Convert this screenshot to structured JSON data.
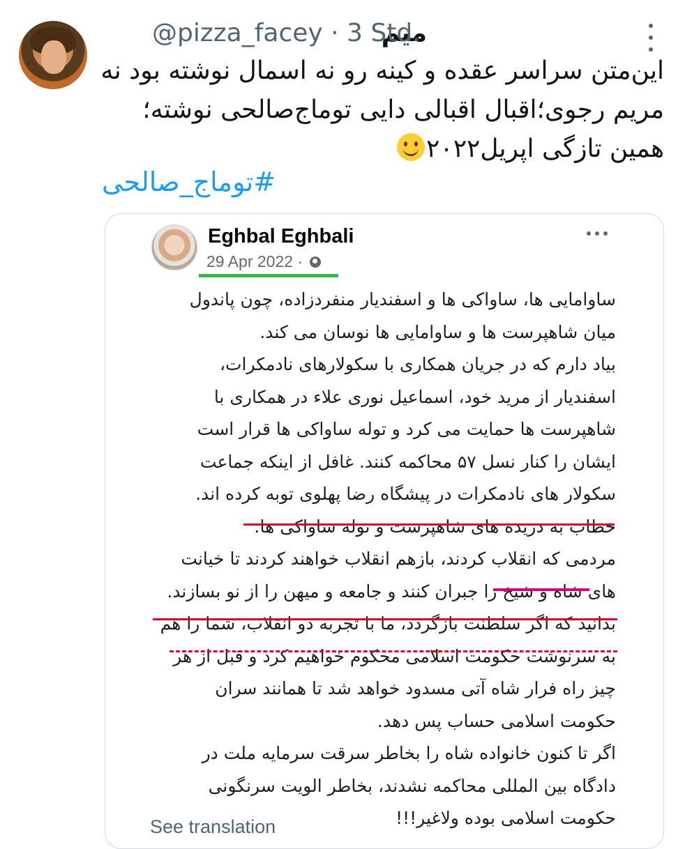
{
  "tweet": {
    "display_name": "میم",
    "handle": "@pizza_facey",
    "separator": "·",
    "time": "3 Std.",
    "text_lines": [
      "این‌متن سراسر عقده و کینه رو نه اسمال نوشته بود نه",
      "مریم رجوی؛اقبال اقبالی دایی توماج‌صالحی نوشته؛",
      "همین تازگی اپریل۲۰۲۲"
    ],
    "emoji": "slightly-smiling-face-icon",
    "hashtag": "#توماج_صالحی"
  },
  "card": {
    "author": "Eghbal Eghbali",
    "date": "29 Apr 2022 ·",
    "privacy_icon": "globe-icon",
    "post_lines": [
      "ساوامایی ها، ساواکی ها و اسفندیار منفردزاده، چون پاندول",
      "میان شاهپرست ها و ساوامایی ها نوسان می کند.",
      "بیاد دارم که در جریان همکاری با سکولارهای نادمکرات،",
      "اسفندیار از مرید خود، اسماعیل نوری علاء در همکاری با",
      "شاهپرست ها حمایت می کرد و توله ساواکی ها قرار است",
      "ایشان را کنار نسل ۵۷ محاکمه کنند. غافل از اینکه جماعت",
      "سکولار های نادمکرات در پیشگاه رضا پهلوی توبه کرده اند.",
      "خطاب به دریده های شاهپرست و توله ساواکی ها:",
      "مردمی که انقلاب کردند، بازهم انقلاب خواهند کردند تا خیانت",
      "های شاه و شیخ را جبران کنند و جامعه و میهن را از نو بسازند.",
      "بدانید که اگر سلطنت بازگردد، ما با تجربه دو انقلاب، شما را هم",
      "به سرنوشت حکومت اسلامی محکوم خواهیم کرد و قبل از هر",
      "چیز راه فرار شاه آتی مسدود خواهد شد تا همانند سران",
      "حکومت اسلامی حساب پس دهد.",
      "اگر تا کنون خانواده شاه را بخاطر سرقت سرمایه ملت در",
      "دادگاه بین المللی محاکمه نشدند، بخاطر الویت سرنگونی",
      "حکومت اسلامی بوده ولاغیر!!!"
    ],
    "see_translation": "See translation"
  },
  "colors": {
    "hashtag": "#1d9bf0",
    "underline_green": "#3db54a",
    "underline_red": "#c8102e",
    "underline_pink": "#d6007a"
  }
}
